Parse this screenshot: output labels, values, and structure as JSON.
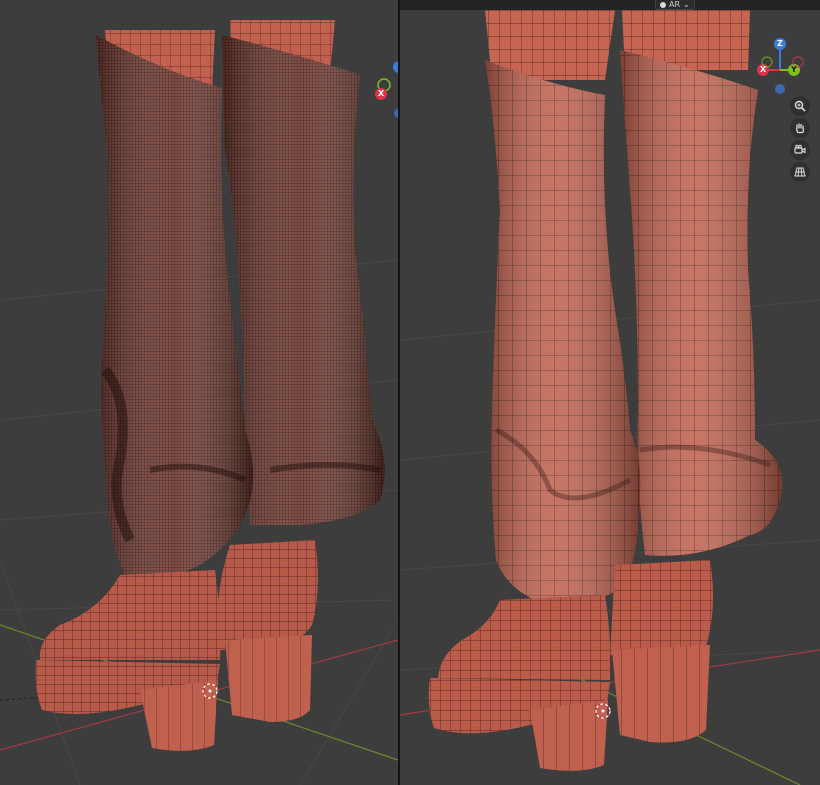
{
  "header": {
    "add_symbol": "+",
    "view_label": "AR",
    "chevron": "⌄"
  },
  "gizmo": {
    "x": "X",
    "y": "Y",
    "z": "Z",
    "colors": {
      "x": "#e0334a",
      "y": "#7fbf1f",
      "z": "#3a7be0"
    }
  },
  "nav_icons": [
    "zoom-icon",
    "hand-pan-icon",
    "camera-icon",
    "grid-perspective-icon"
  ],
  "colors": {
    "mesh": "#b85a4a",
    "mesh_dark": "#6a3a34",
    "background": "#3d3d3d",
    "axis_x_line": "#a33a46",
    "axis_y_line": "#6b8a2a"
  }
}
